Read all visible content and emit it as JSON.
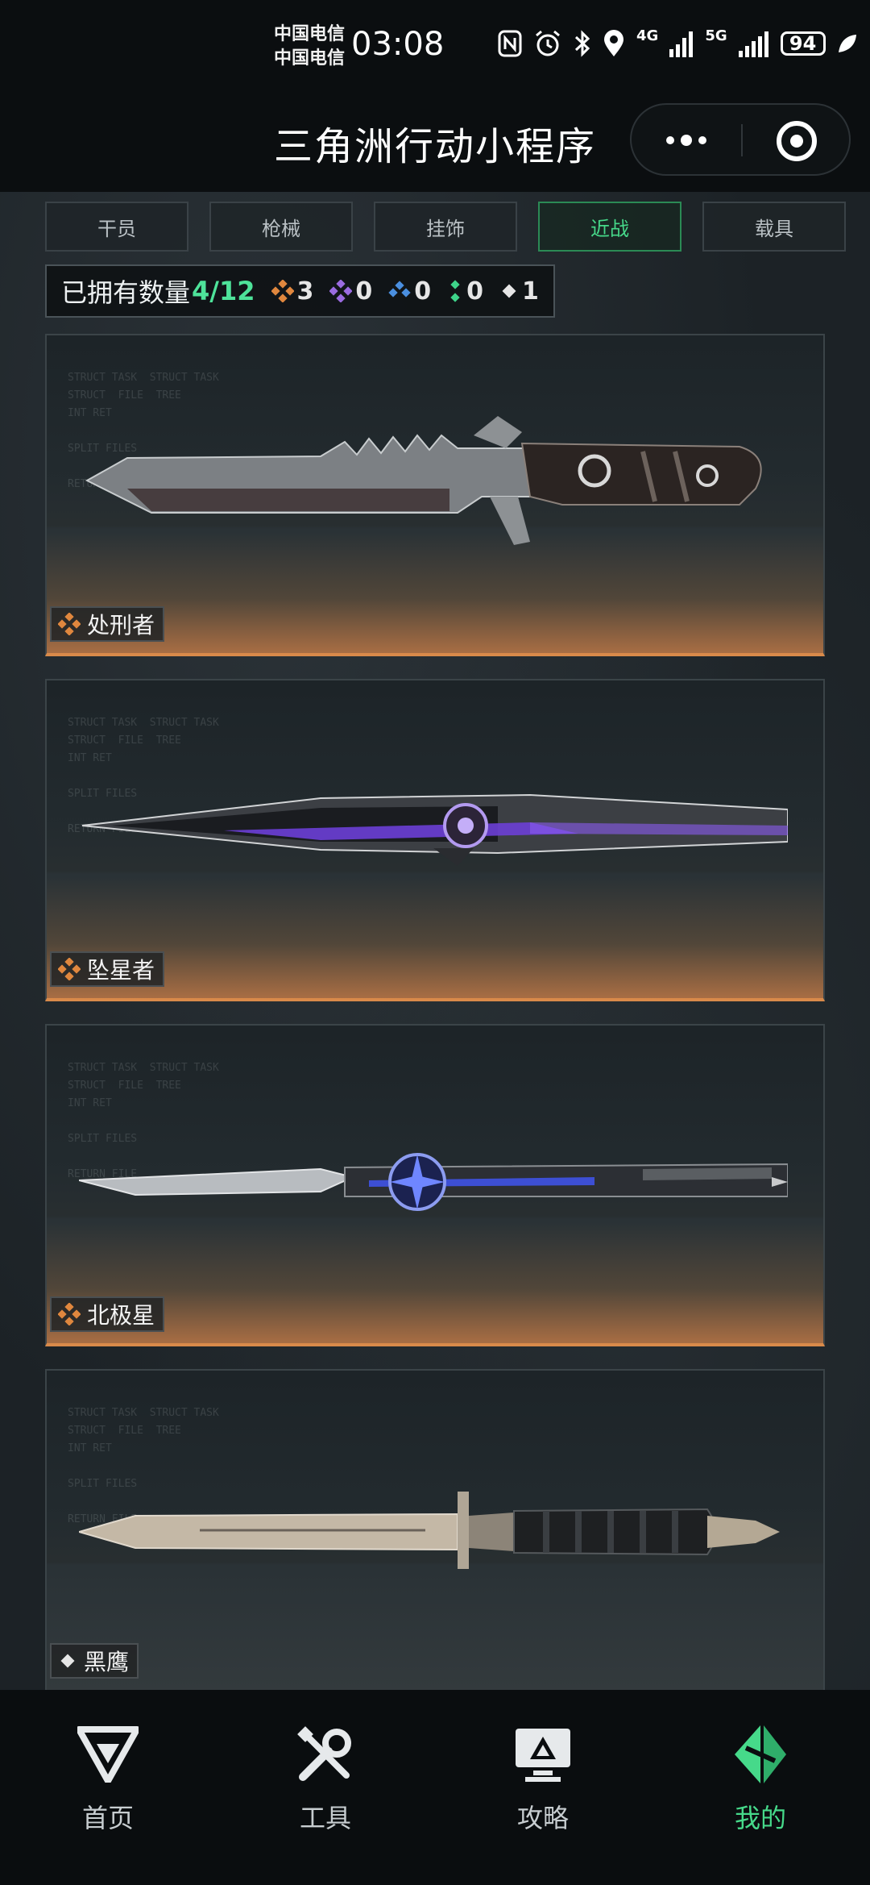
{
  "status_bar": {
    "carrier_1": "中国电信",
    "carrier_2": "中国电信",
    "time": "03:08",
    "network_1": "4G",
    "network_2": "5G",
    "battery": "94"
  },
  "title_bar": {
    "title": "三角洲行动小程序",
    "more_icon": "more-dots-icon",
    "close_icon": "target-close-icon"
  },
  "tabs": [
    {
      "label": "干员",
      "active": false
    },
    {
      "label": "枪械",
      "active": false
    },
    {
      "label": "挂饰",
      "active": false
    },
    {
      "label": "近战",
      "active": true
    },
    {
      "label": "载具",
      "active": false
    }
  ],
  "owned": {
    "label": "已拥有数量",
    "count": "4/12",
    "rarities": [
      {
        "icon": "gold-diamond-icon",
        "color": "#e0873e",
        "value": "3"
      },
      {
        "icon": "purple-diamond-icon",
        "color": "#9a6be0",
        "value": "0"
      },
      {
        "icon": "blue-diamond-icon",
        "color": "#4a8fe0",
        "value": "0"
      },
      {
        "icon": "green-diamond-icon",
        "color": "#3ed48a",
        "value": "0"
      },
      {
        "icon": "white-diamond-icon",
        "color": "#e6e6e6",
        "value": "1"
      }
    ]
  },
  "items": [
    {
      "name": "处刑者",
      "rarity": "gold",
      "color": "#e0873e"
    },
    {
      "name": "坠星者",
      "rarity": "gold",
      "color": "#e0873e"
    },
    {
      "name": "北极星",
      "rarity": "gold",
      "color": "#e0873e"
    },
    {
      "name": "黑鹰",
      "rarity": "white",
      "color": "#e6e6e6"
    }
  ],
  "bottom_nav": [
    {
      "label": "首页",
      "icon": "home-logo-icon",
      "active": false
    },
    {
      "label": "工具",
      "icon": "tools-icon",
      "active": false
    },
    {
      "label": "攻略",
      "icon": "guide-monitor-icon",
      "active": false
    },
    {
      "label": "我的",
      "icon": "profile-logo-icon",
      "active": true
    }
  ],
  "colors": {
    "accent_green": "#46d98a",
    "gold": "#e0873e",
    "background": "#1c2226"
  }
}
